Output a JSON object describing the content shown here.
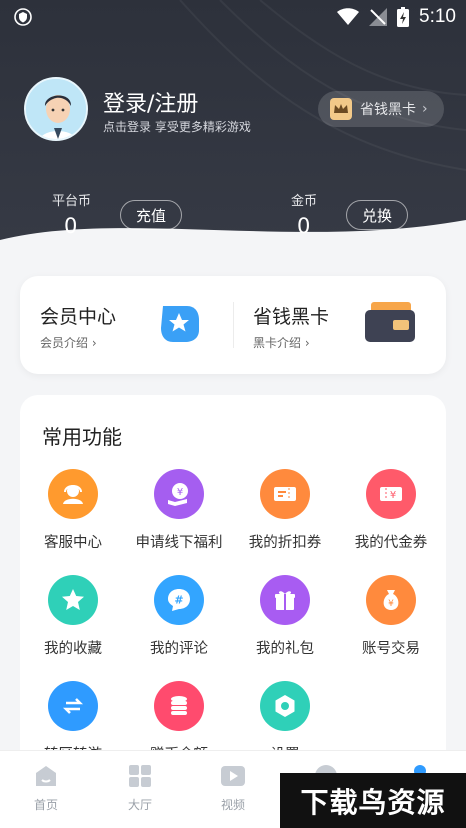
{
  "status": {
    "time": "5:10"
  },
  "profile": {
    "title": "登录/注册",
    "subtitle": "点击登录 享受更多精彩游戏"
  },
  "vip_pill": {
    "label": "省钱黑卡",
    "chevron": "›"
  },
  "coins": [
    {
      "label": "平台币",
      "value": "0",
      "button": "充值"
    },
    {
      "label": "金币",
      "value": "0",
      "button": "兑换"
    }
  ],
  "membership": {
    "left": {
      "title": "会员中心",
      "sub": "会员介绍"
    },
    "right": {
      "title": "省钱黑卡",
      "sub": "黑卡介绍"
    }
  },
  "functions": {
    "title": "常用功能",
    "items": [
      {
        "label": "客服中心",
        "icon": "customer-service-icon",
        "color": "#ff9a2e"
      },
      {
        "label": "申请线下福利",
        "icon": "welfare-icon",
        "color": "#a55ef0"
      },
      {
        "label": "我的折扣券",
        "icon": "discount-coupon-icon",
        "color": "#ff8a3d"
      },
      {
        "label": "我的代金券",
        "icon": "voucher-icon",
        "color": "#ff5a6a"
      },
      {
        "label": "我的收藏",
        "icon": "star-icon",
        "color": "#2fd0b8"
      },
      {
        "label": "我的评论",
        "icon": "comment-icon",
        "color": "#33a5ff"
      },
      {
        "label": "我的礼包",
        "icon": "gift-icon",
        "color": "#a85cf2"
      },
      {
        "label": "账号交易",
        "icon": "money-bag-icon",
        "color": "#ff8a3d"
      },
      {
        "label": "转区转游",
        "icon": "transfer-icon",
        "color": "#2f9bff"
      },
      {
        "label": "赠币余额",
        "icon": "coin-stack-icon",
        "color": "#ff4b6e"
      },
      {
        "label": "设置",
        "icon": "settings-icon",
        "color": "#2fd0b8"
      }
    ]
  },
  "nav": [
    {
      "label": "首页",
      "icon": "home-icon"
    },
    {
      "label": "大厅",
      "icon": "grid-icon"
    },
    {
      "label": "视频",
      "icon": "video-icon"
    },
    {
      "label": "",
      "icon": "message-icon"
    },
    {
      "label": "",
      "icon": "profile-icon"
    }
  ],
  "watermark": "下载鸟资源"
}
